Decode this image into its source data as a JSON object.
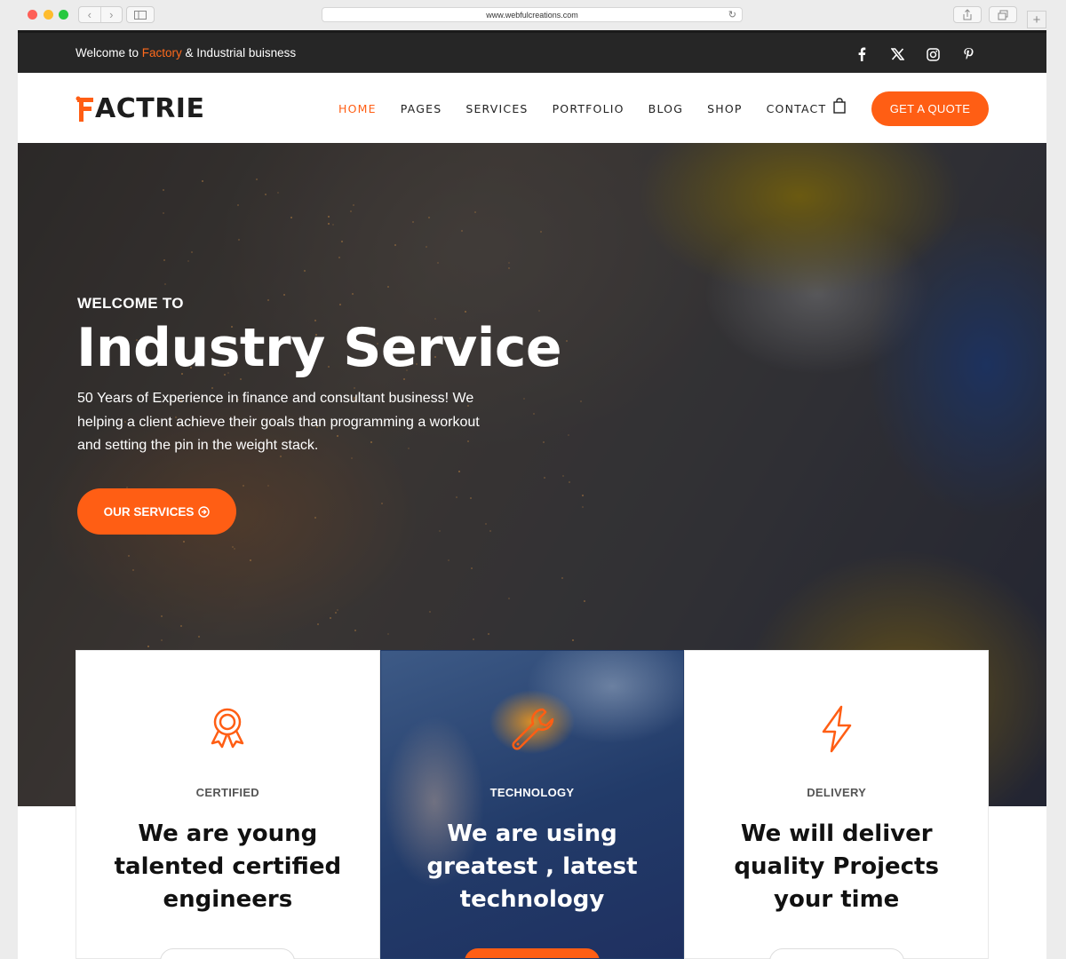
{
  "browser": {
    "url": "www.webfulcreations.com"
  },
  "topbar": {
    "welcome_prefix": "Welcome to ",
    "welcome_highlight": "Factory",
    "welcome_suffix": " & Industrial buisness",
    "socials": [
      "facebook-icon",
      "x-icon",
      "instagram-icon",
      "pinterest-icon"
    ]
  },
  "header": {
    "logo_text": "ACTRIE",
    "nav": [
      "HOME",
      "PAGES",
      "SERVICES",
      "PORTFOLIO",
      "BLOG",
      "SHOP",
      "CONTACT"
    ],
    "quote_button": "GET A QUOTE"
  },
  "hero": {
    "eyebrow": "WELCOME TO",
    "title": "Industry Service",
    "description": "50 Years of Experience in finance and consultant business! We helping a client achieve their goals than programming a workout and setting the pin in the weight stack.",
    "button": "OUR SERVICES"
  },
  "features": [
    {
      "label": "CERTIFIED",
      "heading": "We are young talented certified engineers",
      "icon": "award-icon"
    },
    {
      "label": "TECHNOLOGY",
      "heading": "We are using greatest , latest technology",
      "icon": "wrench-icon"
    },
    {
      "label": "DELIVERY",
      "heading": "We will deliver quality Projects your time",
      "icon": "lightning-icon"
    }
  ],
  "colors": {
    "accent": "#ff5e14",
    "topbar_bg": "#262626"
  }
}
